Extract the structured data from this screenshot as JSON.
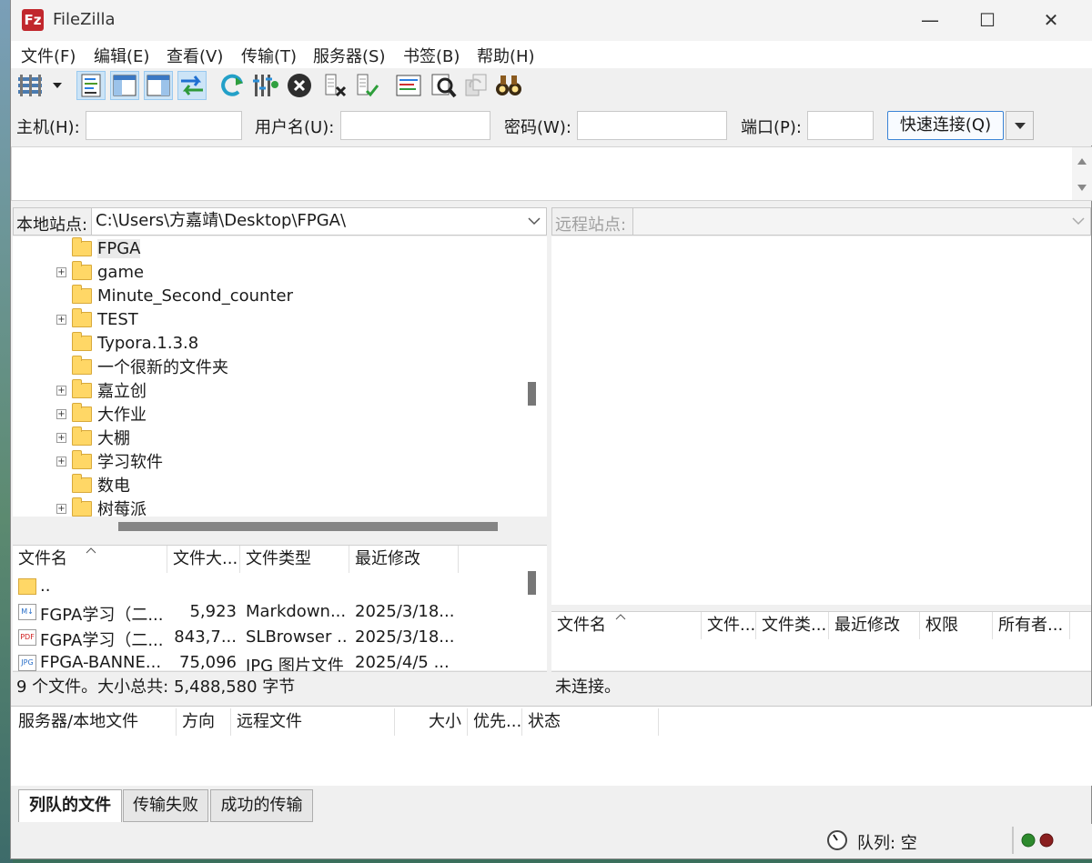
{
  "window": {
    "title": "FileZilla",
    "logo_text": "Fz"
  },
  "controls": {
    "minimize": "—",
    "maximize": "☐",
    "close": "✕"
  },
  "menu": [
    "文件(F)",
    "编辑(E)",
    "查看(V)",
    "传输(T)",
    "服务器(S)",
    "书签(B)",
    "帮助(H)"
  ],
  "quickconnect": {
    "host_label": "主机(H):",
    "host_value": "",
    "user_label": "用户名(U):",
    "user_value": "",
    "pass_label": "密码(W):",
    "pass_value": "",
    "port_label": "端口(P):",
    "port_value": "",
    "connect_label": "快速连接(Q)"
  },
  "local": {
    "site_label": "本地站点:",
    "path": "C:\\Users\\方嘉靖\\Desktop\\FPGA\\",
    "tree": [
      {
        "name": "FPGA",
        "expandable": false,
        "selected": true
      },
      {
        "name": "game",
        "expandable": true
      },
      {
        "name": "Minute_Second_counter",
        "expandable": false
      },
      {
        "name": "TEST",
        "expandable": true
      },
      {
        "name": "Typora.1.3.8",
        "expandable": false
      },
      {
        "name": "一个很新的文件夹",
        "expandable": false
      },
      {
        "name": "嘉立创",
        "expandable": true
      },
      {
        "name": "大作业",
        "expandable": true
      },
      {
        "name": "大棚",
        "expandable": true
      },
      {
        "name": "学习软件",
        "expandable": true
      },
      {
        "name": "数电",
        "expandable": false
      },
      {
        "name": "树莓派",
        "expandable": true
      }
    ],
    "columns": [
      "文件名",
      "文件大...",
      "文件类型",
      "最近修改"
    ],
    "files": [
      {
        "name": "..",
        "size": "",
        "type": "",
        "modified": "",
        "icon": "folder-icon"
      },
      {
        "name": "FGPA学习（二...",
        "size": "5,923",
        "type": "Markdown...",
        "modified": "2025/3/18...",
        "icon": "markdown-file-icon"
      },
      {
        "name": "FGPA学习（二...",
        "size": "843,7...",
        "type": "SLBrowser ...",
        "modified": "2025/3/18...",
        "icon": "pdf-file-icon"
      },
      {
        "name": "FPGA-BANNE...",
        "size": "75,096",
        "type": "JPG 图片文件",
        "modified": "2025/4/5 ...",
        "icon": "image-file-icon"
      }
    ],
    "status": "9 个文件。大小总共: 5,488,580 字节"
  },
  "remote": {
    "site_label": "远程站点:",
    "path": "",
    "columns": [
      "文件名",
      "文件...",
      "文件类...",
      "最近修改",
      "权限",
      "所有者..."
    ],
    "status": "未连接。"
  },
  "queue": {
    "columns": [
      "服务器/本地文件",
      "方向",
      "远程文件",
      "大小",
      "优先...",
      "状态"
    ],
    "tabs": [
      "列队的文件",
      "传输失败",
      "成功的传输"
    ],
    "status": "队列: 空"
  },
  "colors": {
    "accent": "#3b84d6",
    "selection": "#cce4f7",
    "folder": "#ffd766"
  }
}
